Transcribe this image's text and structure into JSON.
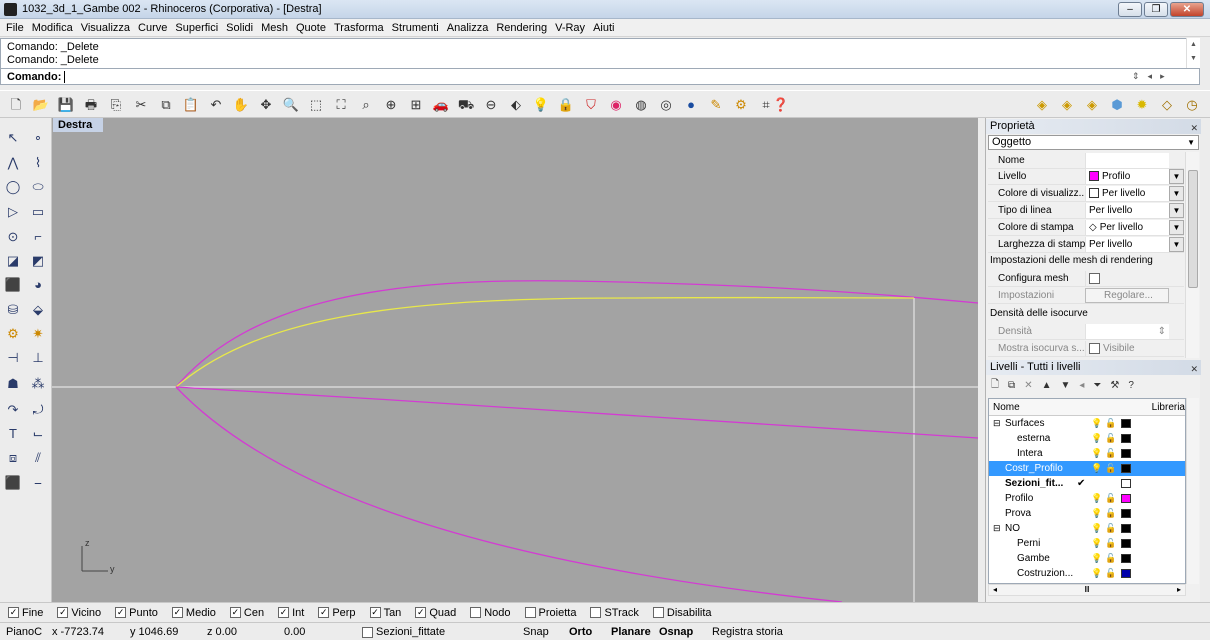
{
  "window": {
    "title": "1032_3d_1_Gambe 002 - Rhinoceros (Corporativa) - [Destra]",
    "minimize": "–",
    "maximize": "❐",
    "close": "✕"
  },
  "menu": [
    "File",
    "Modifica",
    "Visualizza",
    "Curve",
    "Superfici",
    "Solidi",
    "Mesh",
    "Quote",
    "Trasforma",
    "Strumenti",
    "Analizza",
    "Rendering",
    "V-Ray",
    "Aiuti"
  ],
  "command": {
    "history": [
      "Comando: _Delete",
      "Comando: _Delete"
    ],
    "prompt": "Comando:",
    "input": ""
  },
  "viewport": {
    "name": "Destra",
    "axis_z": "z",
    "axis_y": "y"
  },
  "properties": {
    "title": "Proprietà",
    "object_type": "Oggetto",
    "rows": [
      {
        "label": "Nome",
        "value": ""
      },
      {
        "label": "Livello",
        "value": "Profilo",
        "swatch": "#ff00ff"
      },
      {
        "label": "Colore di visualizz...",
        "value": "Per livello",
        "swatch": "#ffffff"
      },
      {
        "label": "Tipo di linea",
        "value": "Per livello"
      },
      {
        "label": "Colore di stampa",
        "value": "Per livello",
        "diamond": "◇"
      },
      {
        "label": "Larghezza di stampa",
        "value": "Per livello"
      }
    ],
    "mesh_section": "Impostazioni delle mesh di rendering",
    "configura": "Configura mesh",
    "impostazioni": "Impostazioni",
    "regolare": "Regolare...",
    "iso_section": "Densità delle isocurve",
    "densita": "Densità",
    "mostra": "Mostra isocurva s...",
    "visibile": "Visibile"
  },
  "layers": {
    "title": "Livelli - Tutti i livelli",
    "col_name": "Nome",
    "col_lib": "Libreria",
    "rows": [
      {
        "name": "Surfaces",
        "indent": 1,
        "expander": "⊟",
        "color": "#000000"
      },
      {
        "name": "esterna",
        "indent": 2,
        "color": "#000000"
      },
      {
        "name": "Intera",
        "indent": 2,
        "color": "#000000"
      },
      {
        "name": "Costr_Profilo",
        "indent": 1,
        "color": "#000000",
        "selected": true
      },
      {
        "name": "Sezioni_fit...",
        "indent": 1,
        "current": "✔",
        "color": "#ffffff",
        "bold": true
      },
      {
        "name": "Profilo",
        "indent": 1,
        "color": "#ff00ff"
      },
      {
        "name": "Prova",
        "indent": 1,
        "color": "#000000"
      },
      {
        "name": "NO",
        "indent": 1,
        "expander": "⊟",
        "color": "#000000"
      },
      {
        "name": "Perni",
        "indent": 2,
        "color": "#000000"
      },
      {
        "name": "Gambe",
        "indent": 2,
        "color": "#000000"
      },
      {
        "name": "Costruzion...",
        "indent": 2,
        "color": "#0000aa"
      }
    ]
  },
  "osnaps": [
    {
      "label": "Fine",
      "checked": true
    },
    {
      "label": "Vicino",
      "checked": true
    },
    {
      "label": "Punto",
      "checked": true
    },
    {
      "label": "Medio",
      "checked": true
    },
    {
      "label": "Cen",
      "checked": true
    },
    {
      "label": "Int",
      "checked": true
    },
    {
      "label": "Perp",
      "checked": true
    },
    {
      "label": "Tan",
      "checked": true
    },
    {
      "label": "Quad",
      "checked": true
    },
    {
      "label": "Nodo",
      "checked": false
    },
    {
      "label": "Proietta",
      "checked": false
    },
    {
      "label": "STrack",
      "checked": false
    },
    {
      "label": "Disabilita",
      "checked": false
    }
  ],
  "status": {
    "cplane": "PianoC",
    "x": "x -7723.74",
    "y": "y 1046.69",
    "z": "z 0.00",
    "val": "0.00",
    "layer": "Sezioni_fittate",
    "snap": "Snap",
    "orto": "Orto",
    "planare": "Planare",
    "osnap": "Osnap",
    "registra": "Registra storia"
  },
  "colors": {
    "curve_magenta": "#d33bd3",
    "curve_yellow": "#e8e84a",
    "axis_white": "#f2f2f2",
    "viewport_bg": "#a3a3a3",
    "selection": "#3399ff"
  }
}
